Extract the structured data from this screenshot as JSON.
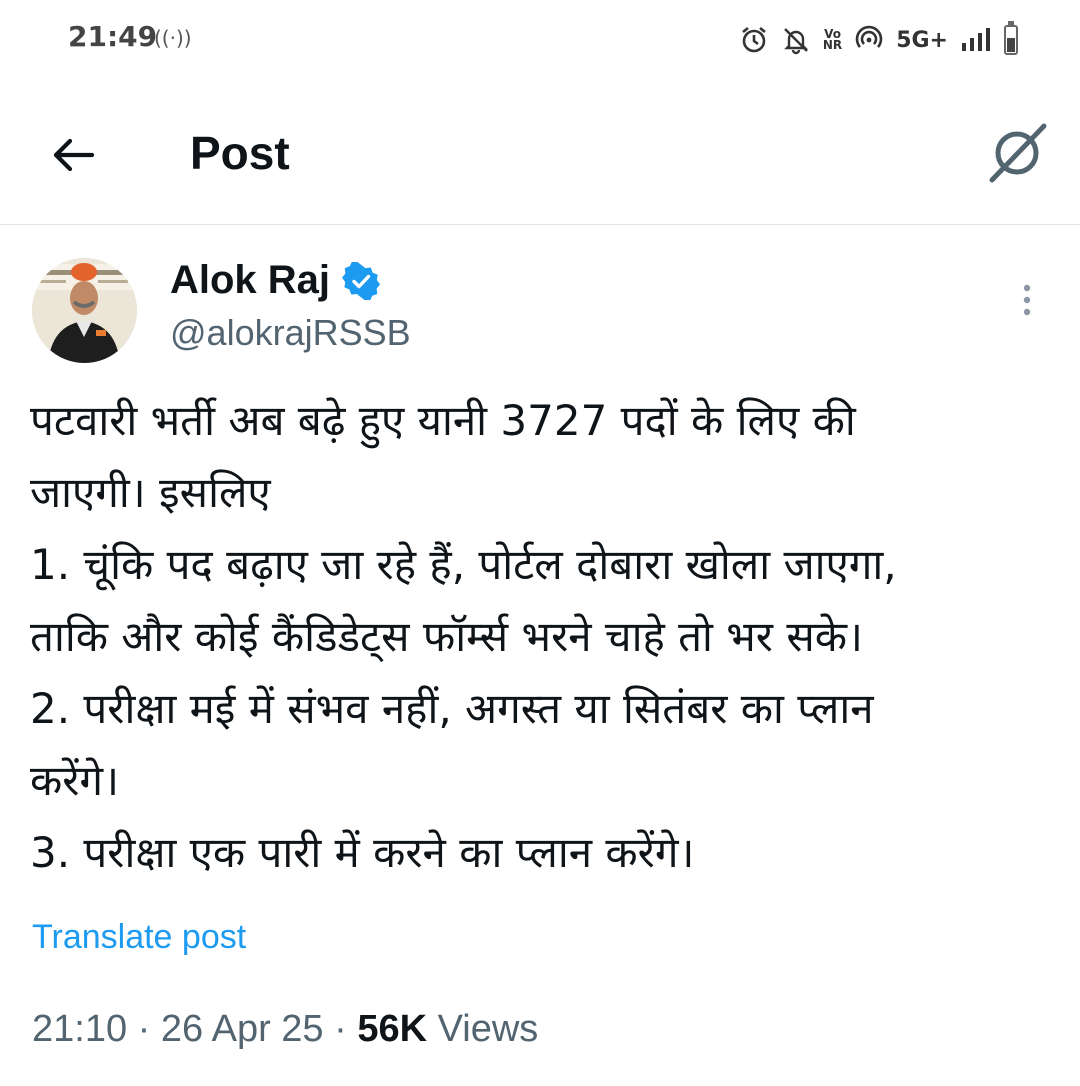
{
  "status_bar": {
    "time": "21:49",
    "hotspot_icon": "hotspot-icon",
    "network": "5G+",
    "volte_top": "Vo",
    "volte_bottom": "NR",
    "battery_level": 0.55
  },
  "header": {
    "title": "Post",
    "back_icon": "arrow-left-icon",
    "grok_icon": "grok-icon"
  },
  "author": {
    "name": "Alok Raj",
    "handle": "@alokrajRSSB",
    "verified": true
  },
  "post": {
    "lines": [
      "पटवारी भर्ती अब बढ़े हुए यानी 3727 पदों के लिए  की",
      "जाएगी। इसलिए",
      "1.  चूंकि पद बढ़ाए जा रहे हैं, पोर्टल दोबारा खोला जाएगा,",
      "ताकि और कोई कैंडिडेट्स फॉर्म्स भरने चाहे तो भर सके।",
      "2. परीक्षा मई में संभव नहीं, अगस्त या सितंबर का प्लान",
      "करेंगे।",
      "3. परीक्षा एक पारी में करने का प्लान करेंगे।"
    ],
    "translate_label": "Translate post",
    "time": "21:10",
    "date": "26 Apr 25",
    "views_count": "56K",
    "views_label": "Views",
    "separator": "·"
  },
  "colors": {
    "link": "#1d9bf0",
    "secondary_text": "#536471",
    "verified_badge": "#1d9bf0"
  }
}
